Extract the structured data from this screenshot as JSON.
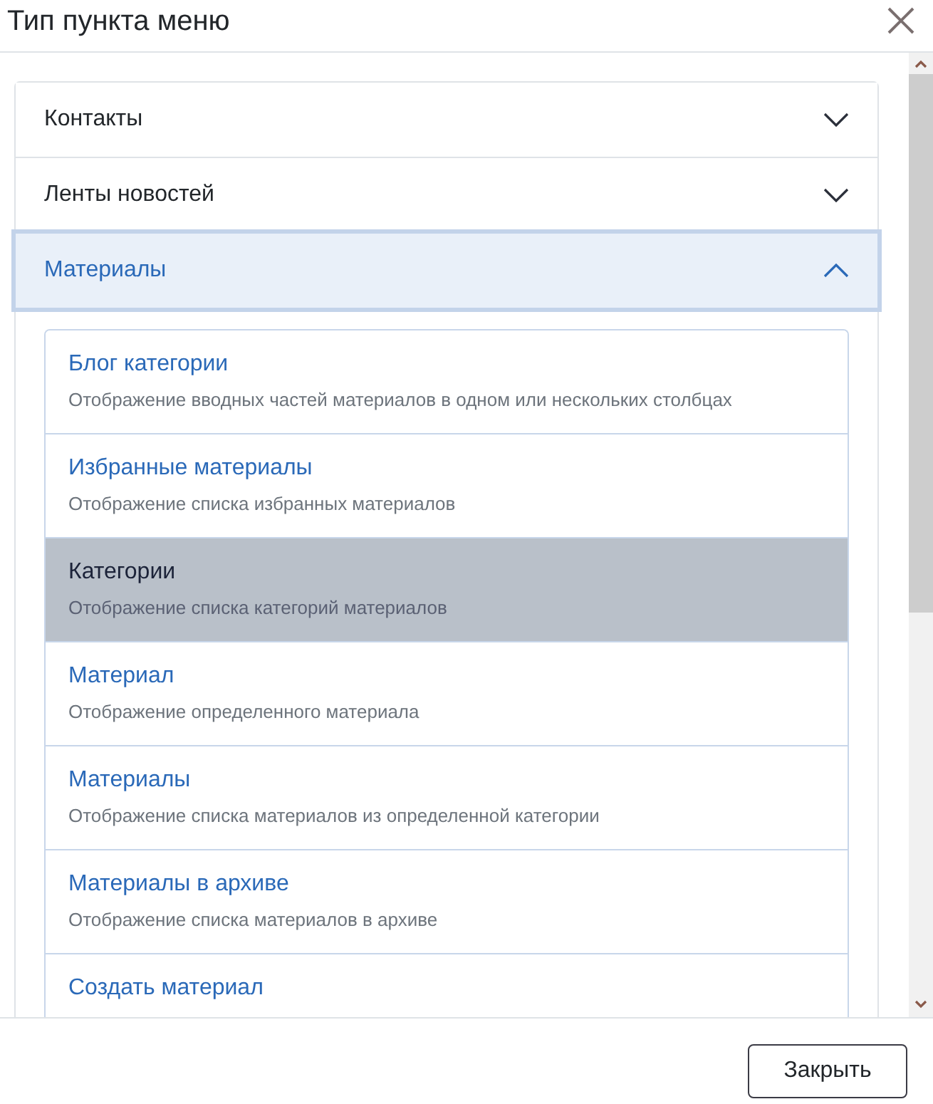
{
  "dialog": {
    "title": "Тип пункта меню"
  },
  "sections": [
    {
      "title": "Контакты",
      "expanded": false
    },
    {
      "title": "Ленты новостей",
      "expanded": false
    },
    {
      "title": "Материалы",
      "expanded": true,
      "items": [
        {
          "title": "Блог категории",
          "description": "Отображение вводных частей материалов в одном или нескольких столбцах",
          "selected": false
        },
        {
          "title": "Избранные материалы",
          "description": "Отображение списка избранных материалов",
          "selected": false
        },
        {
          "title": "Категории",
          "description": "Отображение списка категорий материалов",
          "selected": true
        },
        {
          "title": "Материал",
          "description": "Отображение определенного материала",
          "selected": false
        },
        {
          "title": "Материалы",
          "description": "Отображение списка материалов из определенной категории",
          "selected": false
        },
        {
          "title": "Материалы в архиве",
          "description": "Отображение списка материалов в архиве",
          "selected": false
        },
        {
          "title": "Создать материал",
          "selected": false
        }
      ]
    }
  ],
  "footer": {
    "buttons": [
      {
        "label": "Закрыть"
      }
    ]
  }
}
